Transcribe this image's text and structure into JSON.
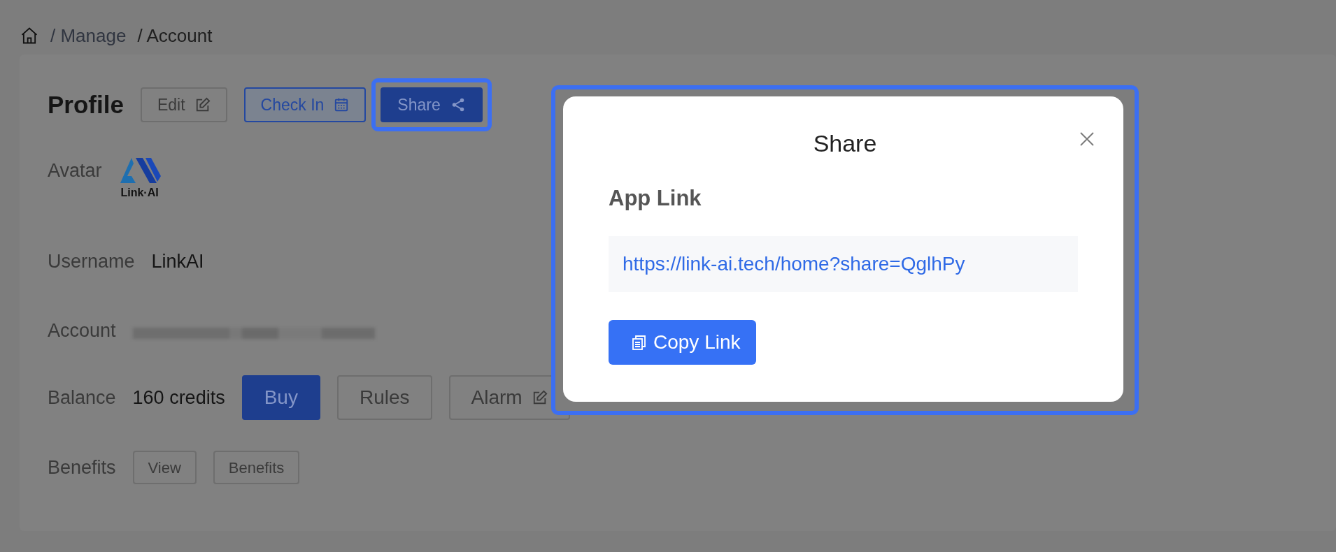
{
  "breadcrumb": [
    {
      "separator": "/",
      "label": "Manage",
      "current": false
    },
    {
      "separator": "/",
      "label": "Account",
      "current": true
    }
  ],
  "profile": {
    "title": "Profile",
    "actions": [
      {
        "label": "Edit",
        "highlighted": false
      },
      {
        "label": "Check In",
        "highlighted": false
      },
      {
        "label": "Share",
        "highlighted": true
      }
    ],
    "fields": [
      {
        "label": "Avatar",
        "kind": "avatar",
        "logo_text": "Link·AI"
      },
      {
        "label": "Username",
        "kind": "text",
        "value": "LinkAI"
      },
      {
        "label": "Account",
        "kind": "redacted"
      },
      {
        "label": "Balance",
        "kind": "text",
        "value": "160 credits",
        "buttons": [
          {
            "label": "Buy"
          },
          {
            "label": "Rules"
          },
          {
            "label": "Alarm"
          }
        ]
      },
      {
        "label": "Benefits",
        "kind": "buttons",
        "buttons": [
          {
            "label": "View"
          },
          {
            "label": "Benefits"
          }
        ]
      }
    ]
  },
  "modal": {
    "title": "Share",
    "highlighted": true,
    "section_title": "App Link",
    "link": "https://link-ai.tech/home?share=QglhPy",
    "button": "Copy Link"
  }
}
